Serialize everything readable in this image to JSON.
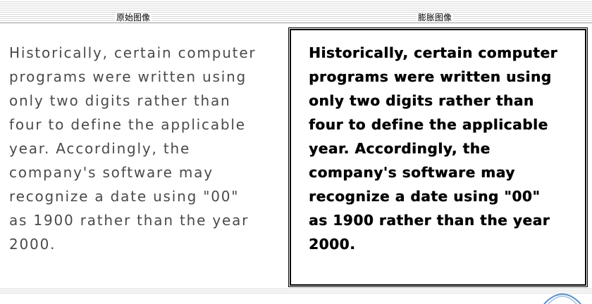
{
  "header": {
    "left_label": "原始图像",
    "right_label": "膨胀图像"
  },
  "panels": {
    "original_text": "Historically, certain computer\nprograms were written using\nonly two digits rather than\nfour to define the applicable\nyear. Accordingly, the\ncompany's software may\nrecognize a date using \"00\"\nas 1900 rather than the year\n2000.",
    "dilated_text": "Historically, certain computer\nprograms were written using\nonly two digits rather than\nfour to define the applicable\nyear. Accordingly, the\ncompany's software may\nrecognize a date using \"00\"\nas 1900 rather than the year\n2000."
  },
  "colors": {
    "original_text_color": "#4a4a4a",
    "dilated_text_color": "#000000",
    "logo_color": "#5b8fc9"
  },
  "icons": {
    "corner_logo": "logo-arc-icon"
  }
}
